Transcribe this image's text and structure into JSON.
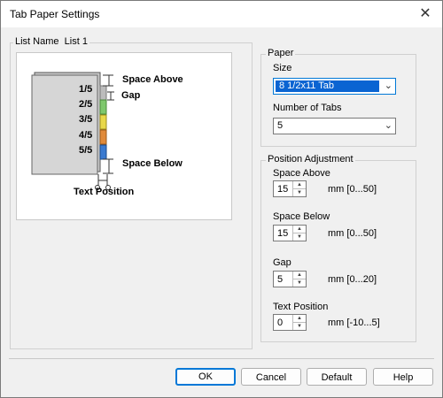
{
  "window": {
    "title": "Tab Paper Settings",
    "close_glyph": "✕"
  },
  "list": {
    "label": "List Name",
    "value": "List 1"
  },
  "preview": {
    "tabs": [
      "1/5",
      "2/5",
      "3/5",
      "4/5",
      "5/5"
    ],
    "labels": {
      "space_above": "Space Above",
      "gap": "Gap",
      "space_below": "Space Below",
      "text_position": "Text Position"
    }
  },
  "paper": {
    "group_label": "Paper",
    "size_label": "Size",
    "size_value": "8 1/2x11 Tab",
    "tabs_label": "Number of Tabs",
    "tabs_value": "5"
  },
  "position": {
    "group_label": "Position Adjustment",
    "fields": [
      {
        "label": "Space Above",
        "value": "15",
        "unit": "mm [0...50]"
      },
      {
        "label": "Space Below",
        "value": "15",
        "unit": "mm [0...50]"
      },
      {
        "label": "Gap",
        "value": "5",
        "unit": "mm [0...20]"
      },
      {
        "label": "Text Position",
        "value": "0",
        "unit": "mm [-10...5]"
      }
    ]
  },
  "buttons": {
    "ok": "OK",
    "cancel": "Cancel",
    "default": "Default",
    "help": "Help"
  },
  "icons": {
    "dropdown": "chevron-down-icon",
    "spin_up": "▲",
    "spin_down": "▼"
  }
}
